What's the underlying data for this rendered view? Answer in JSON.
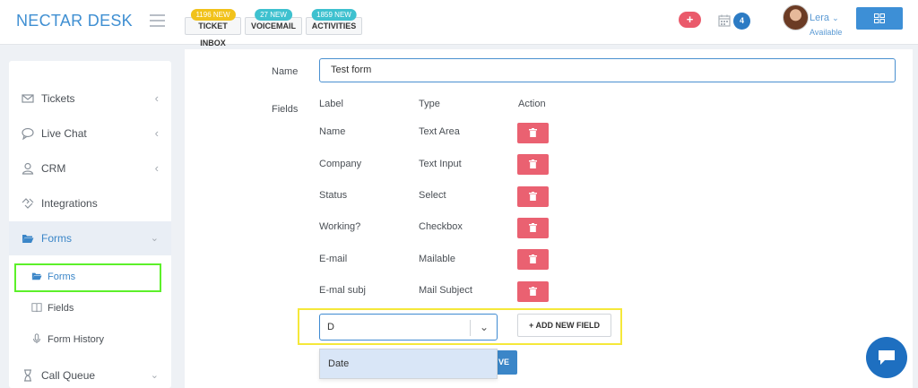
{
  "app": {
    "brand": "NECTAR DESK"
  },
  "header": {
    "quick_buttons": [
      {
        "label": "TICKET INBOX",
        "badge": "1196 NEW",
        "badge_color": "#f1c21b"
      },
      {
        "label": "VOICEMAIL",
        "badge": "27 NEW",
        "badge_color": "#3ec1cf"
      },
      {
        "label": "ACTIVITIES",
        "badge": "1859 NEW",
        "badge_color": "#3ec1cf"
      }
    ],
    "plus_label": "+",
    "calendar_count": "4",
    "user": {
      "name": "Lera",
      "status": "Available"
    }
  },
  "sidebar": {
    "items": [
      {
        "label": "Tickets",
        "icon": "envelope-icon"
      },
      {
        "label": "Live Chat",
        "icon": "chat-bubble-icon"
      },
      {
        "label": "CRM",
        "icon": "user-icon"
      },
      {
        "label": "Integrations",
        "icon": "handshake-icon"
      },
      {
        "label": "Forms",
        "icon": "folder-open-icon"
      },
      {
        "label": "Call Queue",
        "icon": "hourglass-icon"
      }
    ],
    "sub_items": [
      {
        "label": "Forms",
        "icon": "folder-open-icon"
      },
      {
        "label": "Fields",
        "icon": "book-icon"
      },
      {
        "label": "Form History",
        "icon": "microphone-icon"
      }
    ]
  },
  "form": {
    "name_label": "Name",
    "name_value": "Test form",
    "fields_label": "Fields",
    "columns": [
      "Label",
      "Type",
      "Action"
    ],
    "rows": [
      {
        "label": "Name",
        "type": "Text Area"
      },
      {
        "label": "Company",
        "type": "Text Input"
      },
      {
        "label": "Status",
        "type": "Select"
      },
      {
        "label": "Working?",
        "type": "Checkbox"
      },
      {
        "label": "E-mail",
        "type": "Mailable"
      },
      {
        "label": "E-mal subj",
        "type": "Mail Subject"
      }
    ],
    "new_field_select_value": "D",
    "add_button": "+ ADD NEW FIELD",
    "dropdown_option": "Date",
    "save_button_partial": "VE"
  },
  "colors": {
    "brand": "#3f8fd2",
    "delete": "#ea6171",
    "primary": "#3b86c8",
    "highlight_green": "#5cf02a",
    "highlight_yellow": "#f5e83a"
  }
}
